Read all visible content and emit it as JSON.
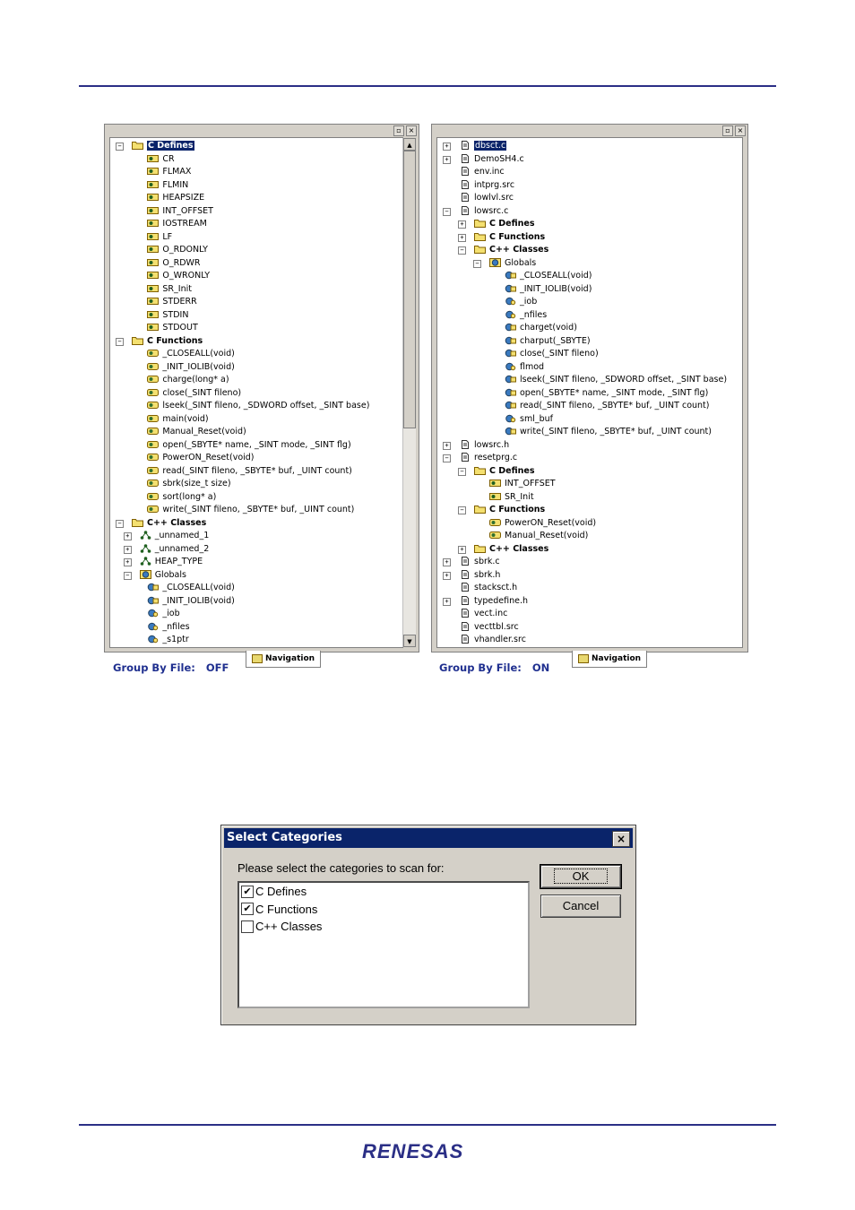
{
  "colors": {
    "accent": "#2b2f86",
    "selection": "#0a246a",
    "window": "#d4d0c8"
  },
  "left_panel": {
    "caption_label": "Group By File:",
    "caption_value": "OFF",
    "tab_label": "Navigation",
    "rows": [
      {
        "text": "C Defines",
        "icon": "folder-icon",
        "bold": true,
        "selected": true,
        "expander": "-"
      },
      {
        "text": "CR",
        "icon": "define-icon"
      },
      {
        "text": "FLMAX",
        "icon": "define-icon"
      },
      {
        "text": "FLMIN",
        "icon": "define-icon"
      },
      {
        "text": "HEAPSIZE",
        "icon": "define-icon"
      },
      {
        "text": "INT_OFFSET",
        "icon": "define-icon"
      },
      {
        "text": "IOSTREAM",
        "icon": "define-icon"
      },
      {
        "text": "LF",
        "icon": "define-icon"
      },
      {
        "text": "O_RDONLY",
        "icon": "define-icon"
      },
      {
        "text": "O_RDWR",
        "icon": "define-icon"
      },
      {
        "text": "O_WRONLY",
        "icon": "define-icon"
      },
      {
        "text": "SR_Init",
        "icon": "define-icon"
      },
      {
        "text": "STDERR",
        "icon": "define-icon"
      },
      {
        "text": "STDIN",
        "icon": "define-icon"
      },
      {
        "text": "STDOUT",
        "icon": "define-icon"
      },
      {
        "text": "C Functions",
        "icon": "folder-icon",
        "bold": true,
        "expander": "-"
      },
      {
        "text": "_CLOSEALL(void)",
        "icon": "function-icon"
      },
      {
        "text": "_INIT_IOLIB(void)",
        "icon": "function-icon"
      },
      {
        "text": "charge(long* a)",
        "icon": "function-icon"
      },
      {
        "text": "close(_SINT fileno)",
        "icon": "function-icon"
      },
      {
        "text": "lseek(_SINT fileno, _SDWORD offset, _SINT base)",
        "icon": "function-icon"
      },
      {
        "text": "main(void)",
        "icon": "function-icon"
      },
      {
        "text": "Manual_Reset(void)",
        "icon": "function-icon"
      },
      {
        "text": "open(_SBYTE* name, _SINT mode, _SINT flg)",
        "icon": "function-icon"
      },
      {
        "text": "PowerON_Reset(void)",
        "icon": "function-icon"
      },
      {
        "text": "read(_SINT fileno, _SBYTE* buf, _UINT count)",
        "icon": "function-icon"
      },
      {
        "text": "sbrk(size_t size)",
        "icon": "function-icon"
      },
      {
        "text": "sort(long* a)",
        "icon": "function-icon"
      },
      {
        "text": "write(_SINT fileno, _SBYTE* buf, _UINT count)",
        "icon": "function-icon"
      },
      {
        "text": "C++ Classes",
        "icon": "folder-icon",
        "bold": true,
        "expander": "-"
      },
      {
        "text": "_unnamed_1",
        "icon": "class-icon",
        "expander": "+"
      },
      {
        "text": "_unnamed_2",
        "icon": "class-icon",
        "expander": "+"
      },
      {
        "text": "HEAP_TYPE",
        "icon": "class-icon",
        "expander": "+"
      },
      {
        "text": "Globals",
        "icon": "globals-icon",
        "expander": "-"
      },
      {
        "text": "_CLOSEALL(void)",
        "icon": "global-function-icon"
      },
      {
        "text": "_INIT_IOLIB(void)",
        "icon": "global-function-icon"
      },
      {
        "text": "_iob",
        "icon": "global-variable-icon"
      },
      {
        "text": "_nfiles",
        "icon": "global-variable-icon"
      },
      {
        "text": "_s1ptr",
        "icon": "global-variable-icon"
      }
    ]
  },
  "right_panel": {
    "caption_label": "Group By File:",
    "caption_value": "ON",
    "tab_label": "Navigation",
    "rows": [
      {
        "text": "dbsct.c",
        "icon": "file-icon",
        "selected": true,
        "expander": "+"
      },
      {
        "text": "DemoSH4.c",
        "icon": "file-icon",
        "expander": "+"
      },
      {
        "text": "env.inc",
        "icon": "file-icon"
      },
      {
        "text": "intprg.src",
        "icon": "file-icon"
      },
      {
        "text": "lowlvl.src",
        "icon": "file-icon"
      },
      {
        "text": "lowsrc.c",
        "icon": "file-icon",
        "expander": "-"
      },
      {
        "text": "C Defines",
        "icon": "folder-icon",
        "bold": true,
        "expander": "+"
      },
      {
        "text": "C Functions",
        "icon": "folder-icon",
        "bold": true,
        "expander": "+"
      },
      {
        "text": "C++ Classes",
        "icon": "folder-icon",
        "bold": true,
        "expander": "-"
      },
      {
        "text": "Globals",
        "icon": "globals-icon",
        "expander": "-"
      },
      {
        "text": "_CLOSEALL(void)",
        "icon": "global-function-icon"
      },
      {
        "text": "_INIT_IOLIB(void)",
        "icon": "global-function-icon"
      },
      {
        "text": "_iob",
        "icon": "global-variable-icon"
      },
      {
        "text": "_nfiles",
        "icon": "global-variable-icon"
      },
      {
        "text": "charget(void)",
        "icon": "global-function-icon"
      },
      {
        "text": "charput(_SBYTE)",
        "icon": "global-function-icon"
      },
      {
        "text": "close(_SINT fileno)",
        "icon": "global-function-icon"
      },
      {
        "text": "flmod",
        "icon": "global-variable-icon"
      },
      {
        "text": "lseek(_SINT fileno, _SDWORD offset, _SINT base)",
        "icon": "global-function-icon"
      },
      {
        "text": "open(_SBYTE* name, _SINT mode, _SINT flg)",
        "icon": "global-function-icon"
      },
      {
        "text": "read(_SINT fileno, _SBYTE* buf, _UINT count)",
        "icon": "global-function-icon"
      },
      {
        "text": "sml_buf",
        "icon": "global-variable-icon"
      },
      {
        "text": "write(_SINT fileno, _SBYTE* buf, _UINT count)",
        "icon": "global-function-icon"
      },
      {
        "text": "lowsrc.h",
        "icon": "file-icon",
        "expander": "+"
      },
      {
        "text": "resetprg.c",
        "icon": "file-icon",
        "expander": "-"
      },
      {
        "text": "C Defines",
        "icon": "folder-icon",
        "bold": true,
        "expander": "-"
      },
      {
        "text": "INT_OFFSET",
        "icon": "define-icon"
      },
      {
        "text": "SR_Init",
        "icon": "define-icon"
      },
      {
        "text": "C Functions",
        "icon": "folder-icon",
        "bold": true,
        "expander": "-"
      },
      {
        "text": "PowerON_Reset(void)",
        "icon": "function-icon"
      },
      {
        "text": "Manual_Reset(void)",
        "icon": "function-icon"
      },
      {
        "text": "C++ Classes",
        "icon": "folder-icon",
        "bold": true,
        "expander": "+"
      },
      {
        "text": "sbrk.c",
        "icon": "file-icon",
        "expander": "+"
      },
      {
        "text": "sbrk.h",
        "icon": "file-icon",
        "expander": "+"
      },
      {
        "text": "stacksct.h",
        "icon": "file-icon"
      },
      {
        "text": "typedefine.h",
        "icon": "file-icon",
        "expander": "+"
      },
      {
        "text": "vect.inc",
        "icon": "file-icon"
      },
      {
        "text": "vecttbl.src",
        "icon": "file-icon"
      },
      {
        "text": "vhandler.src",
        "icon": "file-icon"
      }
    ]
  },
  "dialog": {
    "title": "Select Categories",
    "prompt": "Please select the categories to scan for:",
    "categories": [
      {
        "label": "C Defines",
        "checked": true
      },
      {
        "label": "C Functions",
        "checked": true
      },
      {
        "label": "C++ Classes",
        "checked": false
      }
    ],
    "ok_label": "OK",
    "cancel_label": "Cancel"
  },
  "footer": {
    "logo_text": "RENESAS"
  }
}
